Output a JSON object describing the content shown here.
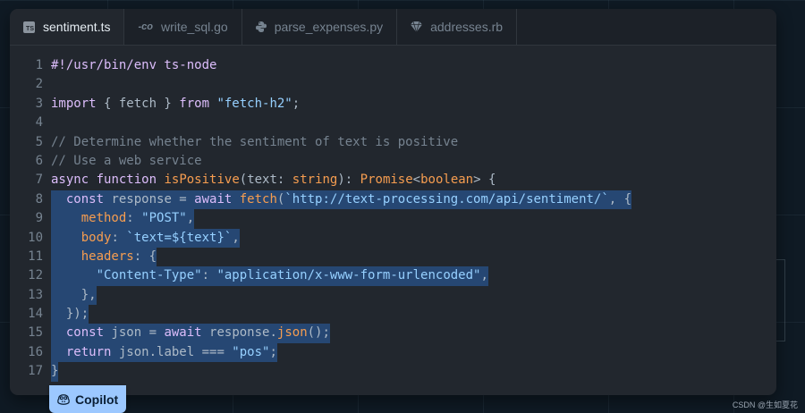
{
  "tabs": [
    {
      "label": "sentiment.ts",
      "icon": "typescript-file-icon",
      "active": true
    },
    {
      "label": "write_sql.go",
      "icon": "go-file-icon",
      "active": false
    },
    {
      "label": "parse_expenses.py",
      "icon": "python-file-icon",
      "active": false
    },
    {
      "label": "addresses.rb",
      "icon": "ruby-file-icon",
      "active": false
    }
  ],
  "icons": {
    "ts_badge": "TS",
    "go": "-co"
  },
  "line_numbers": [
    "1",
    "2",
    "3",
    "4",
    "5",
    "6",
    "7",
    "8",
    "9",
    "10",
    "11",
    "12",
    "13",
    "14",
    "15",
    "16",
    "17"
  ],
  "code": {
    "l1": "#!/usr/bin/env ts-node",
    "l3": {
      "kw": "import",
      "mid": " { fetch } ",
      "from": "from",
      "str": "\"fetch-h2\"",
      "end": ";"
    },
    "l5": "// Determine whether the sentiment of text is positive",
    "l6": "// Use a web service",
    "l7": {
      "async": "async",
      "function": "function",
      "name": "isPositive",
      "p1": "(text: ",
      "type1": "string",
      "p2": "): ",
      "type2": "Promise",
      "p3": "<",
      "type3": "boolean",
      "p4": "> {"
    },
    "l8": {
      "indent": "  ",
      "const": "const",
      "mid": " response = ",
      "await": "await",
      "fetch": " fetch",
      "p1": "(",
      "str": "`http://text-processing.com/api/sentiment/`",
      "end": ", {"
    },
    "l9": {
      "indent": "    ",
      "prop": "method",
      "p": ": ",
      "str": "\"POST\"",
      "end": ","
    },
    "l10": {
      "indent": "    ",
      "prop": "body",
      "p": ": ",
      "str": "`text=${text}`",
      "end": ","
    },
    "l11": {
      "indent": "    ",
      "prop": "headers",
      "p": ": {"
    },
    "l12": {
      "indent": "      ",
      "str1": "\"Content-Type\"",
      "p": ": ",
      "str2": "\"application/x-www-form-urlencoded\"",
      "end": ","
    },
    "l13": "    },",
    "l14": "  });",
    "l15": {
      "indent": "  ",
      "const": "const",
      "mid": " json = ",
      "await": "await",
      "obj": " response.",
      "fn": "json",
      "end": "();"
    },
    "l16": {
      "indent": "  ",
      "ret": "return",
      "mid": " json.label === ",
      "str": "\"pos\"",
      "end": ";"
    },
    "l17": "}"
  },
  "copilot": {
    "label": "Copilot",
    "icon": "copilot-icon"
  },
  "watermark": "CSDN @生如夏花"
}
